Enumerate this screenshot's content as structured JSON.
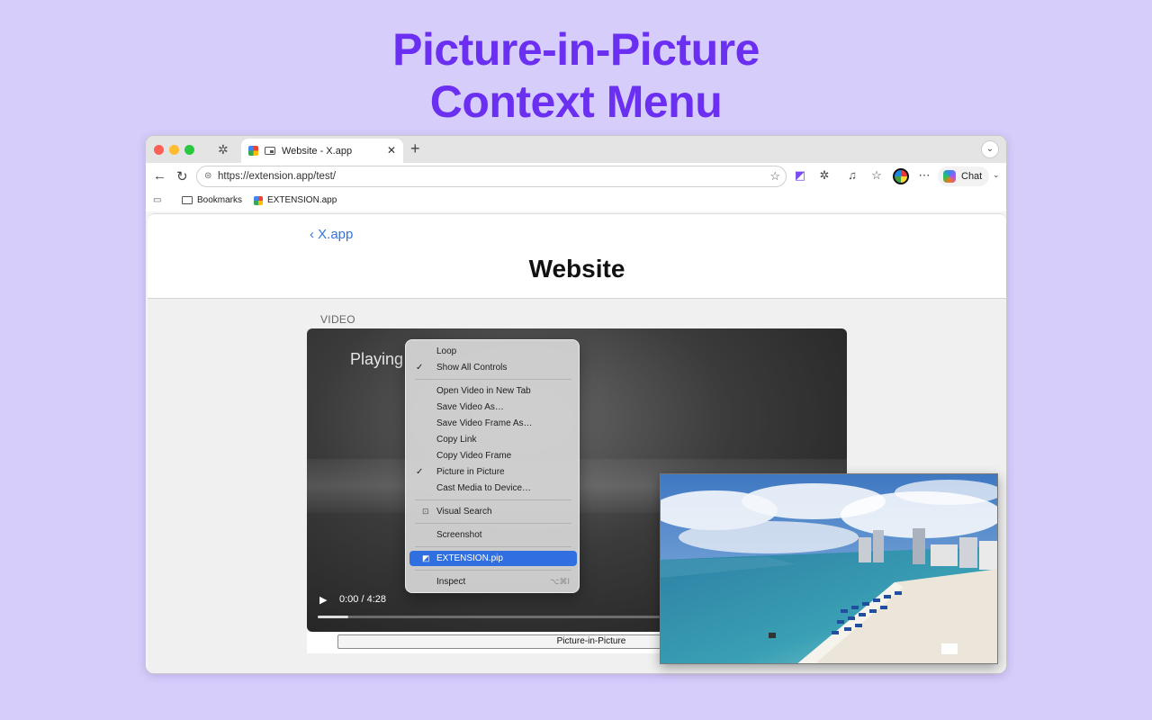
{
  "hero": {
    "line1": "Picture-in-Picture",
    "line2": "Context Menu"
  },
  "browser": {
    "tab_title": "Website - X.app",
    "url": "https://extension.app/test/",
    "chat_label": "Chat",
    "bookmarks": [
      {
        "label": "Bookmarks"
      },
      {
        "label": "EXTENSION.app"
      }
    ]
  },
  "page": {
    "back_label": "X.app",
    "title": "Website",
    "section_label": "VIDEO",
    "video_caption": "Playing",
    "video_time": "0:00 / 4:28",
    "video_progress": 0.09,
    "pip_button_label": "Picture-in-Picture"
  },
  "context_menu": {
    "items": [
      {
        "label": "Loop",
        "checked": false
      },
      {
        "label": "Show All Controls",
        "checked": true
      },
      {
        "label": "Open Video in New Tab"
      },
      {
        "label": "Save Video As…"
      },
      {
        "label": "Save Video Frame As…"
      },
      {
        "label": "Copy Link"
      },
      {
        "label": "Copy Video Frame"
      },
      {
        "label": "Picture in Picture",
        "checked": true
      },
      {
        "label": "Cast Media to Device…"
      },
      {
        "label": "Visual Search",
        "icon": "visual-search-icon"
      },
      {
        "label": "Screenshot"
      },
      {
        "label": "EXTENSION.pip",
        "highlighted": true,
        "icon": "extension-pip-icon"
      },
      {
        "label": "Inspect",
        "shortcut": "⌥⌘I"
      }
    ]
  },
  "colors": {
    "background": "#d7cdfb",
    "hero": "#6a2ff0",
    "link": "#2f74e0",
    "menu_highlight": "#2f6fe0"
  }
}
